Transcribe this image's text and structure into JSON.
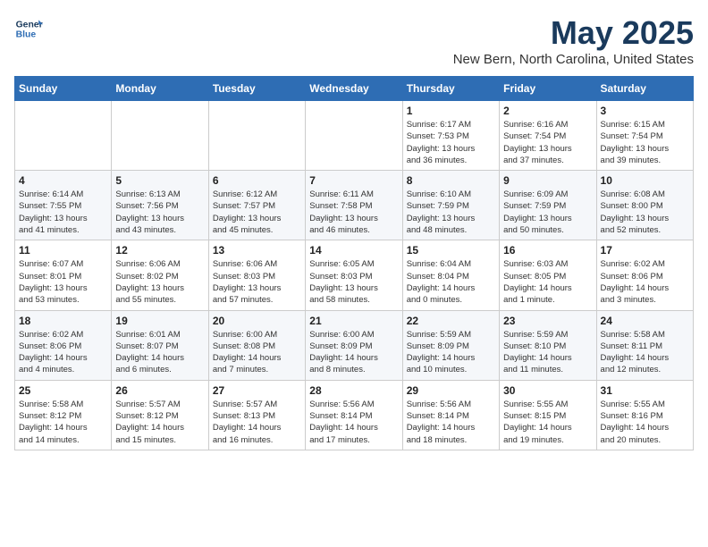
{
  "header": {
    "logo_line1": "General",
    "logo_line2": "Blue",
    "title": "May 2025",
    "subtitle": "New Bern, North Carolina, United States"
  },
  "weekdays": [
    "Sunday",
    "Monday",
    "Tuesday",
    "Wednesday",
    "Thursday",
    "Friday",
    "Saturday"
  ],
  "weeks": [
    [
      {
        "day": "",
        "info": ""
      },
      {
        "day": "",
        "info": ""
      },
      {
        "day": "",
        "info": ""
      },
      {
        "day": "",
        "info": ""
      },
      {
        "day": "1",
        "info": "Sunrise: 6:17 AM\nSunset: 7:53 PM\nDaylight: 13 hours\nand 36 minutes."
      },
      {
        "day": "2",
        "info": "Sunrise: 6:16 AM\nSunset: 7:54 PM\nDaylight: 13 hours\nand 37 minutes."
      },
      {
        "day": "3",
        "info": "Sunrise: 6:15 AM\nSunset: 7:54 PM\nDaylight: 13 hours\nand 39 minutes."
      }
    ],
    [
      {
        "day": "4",
        "info": "Sunrise: 6:14 AM\nSunset: 7:55 PM\nDaylight: 13 hours\nand 41 minutes."
      },
      {
        "day": "5",
        "info": "Sunrise: 6:13 AM\nSunset: 7:56 PM\nDaylight: 13 hours\nand 43 minutes."
      },
      {
        "day": "6",
        "info": "Sunrise: 6:12 AM\nSunset: 7:57 PM\nDaylight: 13 hours\nand 45 minutes."
      },
      {
        "day": "7",
        "info": "Sunrise: 6:11 AM\nSunset: 7:58 PM\nDaylight: 13 hours\nand 46 minutes."
      },
      {
        "day": "8",
        "info": "Sunrise: 6:10 AM\nSunset: 7:59 PM\nDaylight: 13 hours\nand 48 minutes."
      },
      {
        "day": "9",
        "info": "Sunrise: 6:09 AM\nSunset: 7:59 PM\nDaylight: 13 hours\nand 50 minutes."
      },
      {
        "day": "10",
        "info": "Sunrise: 6:08 AM\nSunset: 8:00 PM\nDaylight: 13 hours\nand 52 minutes."
      }
    ],
    [
      {
        "day": "11",
        "info": "Sunrise: 6:07 AM\nSunset: 8:01 PM\nDaylight: 13 hours\nand 53 minutes."
      },
      {
        "day": "12",
        "info": "Sunrise: 6:06 AM\nSunset: 8:02 PM\nDaylight: 13 hours\nand 55 minutes."
      },
      {
        "day": "13",
        "info": "Sunrise: 6:06 AM\nSunset: 8:03 PM\nDaylight: 13 hours\nand 57 minutes."
      },
      {
        "day": "14",
        "info": "Sunrise: 6:05 AM\nSunset: 8:03 PM\nDaylight: 13 hours\nand 58 minutes."
      },
      {
        "day": "15",
        "info": "Sunrise: 6:04 AM\nSunset: 8:04 PM\nDaylight: 14 hours\nand 0 minutes."
      },
      {
        "day": "16",
        "info": "Sunrise: 6:03 AM\nSunset: 8:05 PM\nDaylight: 14 hours\nand 1 minute."
      },
      {
        "day": "17",
        "info": "Sunrise: 6:02 AM\nSunset: 8:06 PM\nDaylight: 14 hours\nand 3 minutes."
      }
    ],
    [
      {
        "day": "18",
        "info": "Sunrise: 6:02 AM\nSunset: 8:06 PM\nDaylight: 14 hours\nand 4 minutes."
      },
      {
        "day": "19",
        "info": "Sunrise: 6:01 AM\nSunset: 8:07 PM\nDaylight: 14 hours\nand 6 minutes."
      },
      {
        "day": "20",
        "info": "Sunrise: 6:00 AM\nSunset: 8:08 PM\nDaylight: 14 hours\nand 7 minutes."
      },
      {
        "day": "21",
        "info": "Sunrise: 6:00 AM\nSunset: 8:09 PM\nDaylight: 14 hours\nand 8 minutes."
      },
      {
        "day": "22",
        "info": "Sunrise: 5:59 AM\nSunset: 8:09 PM\nDaylight: 14 hours\nand 10 minutes."
      },
      {
        "day": "23",
        "info": "Sunrise: 5:59 AM\nSunset: 8:10 PM\nDaylight: 14 hours\nand 11 minutes."
      },
      {
        "day": "24",
        "info": "Sunrise: 5:58 AM\nSunset: 8:11 PM\nDaylight: 14 hours\nand 12 minutes."
      }
    ],
    [
      {
        "day": "25",
        "info": "Sunrise: 5:58 AM\nSunset: 8:12 PM\nDaylight: 14 hours\nand 14 minutes."
      },
      {
        "day": "26",
        "info": "Sunrise: 5:57 AM\nSunset: 8:12 PM\nDaylight: 14 hours\nand 15 minutes."
      },
      {
        "day": "27",
        "info": "Sunrise: 5:57 AM\nSunset: 8:13 PM\nDaylight: 14 hours\nand 16 minutes."
      },
      {
        "day": "28",
        "info": "Sunrise: 5:56 AM\nSunset: 8:14 PM\nDaylight: 14 hours\nand 17 minutes."
      },
      {
        "day": "29",
        "info": "Sunrise: 5:56 AM\nSunset: 8:14 PM\nDaylight: 14 hours\nand 18 minutes."
      },
      {
        "day": "30",
        "info": "Sunrise: 5:55 AM\nSunset: 8:15 PM\nDaylight: 14 hours\nand 19 minutes."
      },
      {
        "day": "31",
        "info": "Sunrise: 5:55 AM\nSunset: 8:16 PM\nDaylight: 14 hours\nand 20 minutes."
      }
    ]
  ]
}
